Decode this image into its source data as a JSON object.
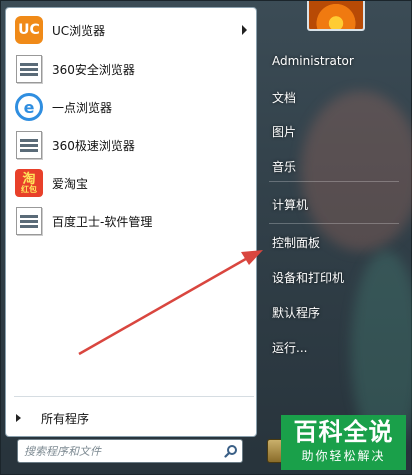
{
  "programs": [
    {
      "label": "UC浏览器",
      "icon": "uc-browser-icon",
      "has_submenu": true
    },
    {
      "label": "360安全浏览器",
      "icon": "app-window-icon",
      "has_submenu": false
    },
    {
      "label": "一点浏览器",
      "icon": "e-browser-icon",
      "has_submenu": false
    },
    {
      "label": "360极速浏览器",
      "icon": "app-window-icon",
      "has_submenu": false
    },
    {
      "label": "爱淘宝",
      "icon": "taobao-icon",
      "has_submenu": false
    },
    {
      "label": "百度卫士-软件管理",
      "icon": "app-window-icon",
      "has_submenu": false
    }
  ],
  "icons_text": {
    "uc": "UC",
    "e": "e",
    "taobao_top": "淘",
    "taobao_bottom": "红包"
  },
  "all_programs_label": "所有程序",
  "search": {
    "placeholder": "搜索程序和文件"
  },
  "right_menu": [
    {
      "label": "Administrator"
    },
    {
      "label": "文档"
    },
    {
      "label": "图片"
    },
    {
      "label": "音乐"
    },
    {
      "label": "计算机"
    },
    {
      "label": "控制面板"
    },
    {
      "label": "设备和打印机"
    },
    {
      "label": "默认程序"
    },
    {
      "label": "运行..."
    }
  ],
  "watermark": {
    "title": "百科全说",
    "subtitle": "助你轻松解决"
  },
  "colors": {
    "annotation_arrow": "#d9463f",
    "watermark_bg": "#1aa04a"
  }
}
